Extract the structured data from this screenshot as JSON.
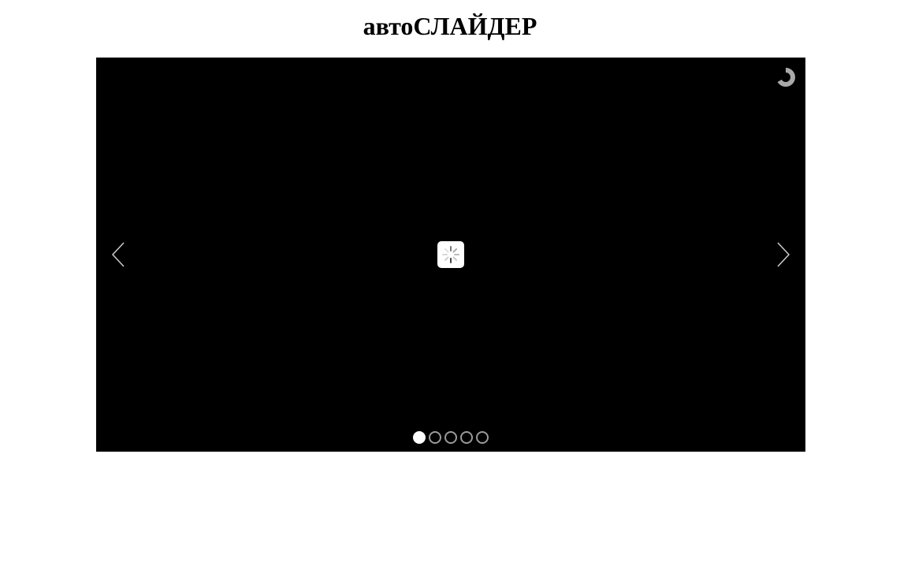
{
  "page": {
    "title": "автоСЛАЙДЕР"
  },
  "slider": {
    "background": "#000000",
    "arrow_color": "#cccccc",
    "prev_icon": "chevron-left-icon",
    "next_icon": "chevron-right-icon",
    "timer_icon": "autoplay-timer-icon",
    "loader_icon": "loading-spinner-icon",
    "slide_count": 5,
    "active_slide": 1,
    "bullets": [
      {
        "state": "active"
      },
      {
        "state": "inactive"
      },
      {
        "state": "inactive"
      },
      {
        "state": "inactive"
      },
      {
        "state": "inactive"
      }
    ]
  }
}
